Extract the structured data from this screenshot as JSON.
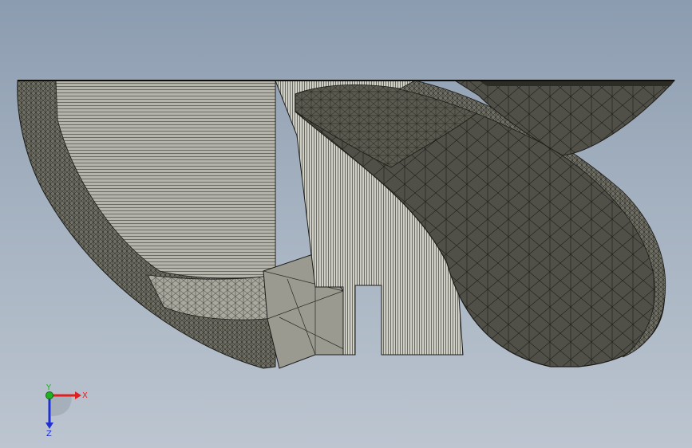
{
  "viewport": {
    "background_top": "#8c9cb0",
    "background_bottom": "#bcc5d0",
    "content": "triangulated-mesh-render"
  },
  "mesh_colors": {
    "light_face": "#c8c8be",
    "mid_face": "#8e8e84",
    "dark_face": "#55554c",
    "edge": "#1c1c18"
  },
  "triad": {
    "x_label": "X",
    "y_label": "Y",
    "z_label": "Z",
    "x_color": "#e02020",
    "y_color": "#20b020",
    "z_color": "#2030d0"
  }
}
